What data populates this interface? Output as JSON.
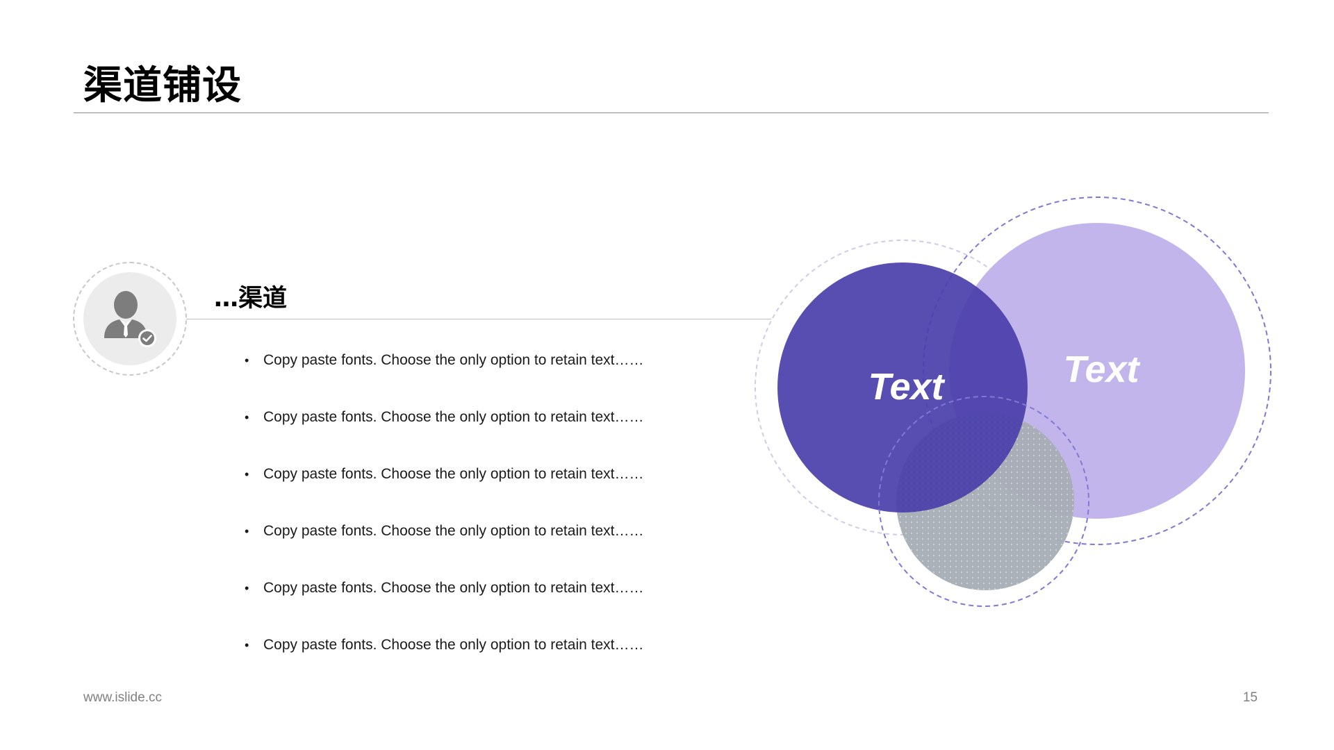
{
  "page": {
    "title": "渠道铺设",
    "footer_url": "www.islide.cc",
    "page_number": "15"
  },
  "section": {
    "title": "…渠道",
    "icon": "businessman-check-icon",
    "bullets": [
      "Copy paste fonts. Choose the only option to retain text……",
      "Copy paste fonts. Choose the only option to retain text……",
      "Copy paste fonts. Choose the only option to retain text……",
      "Copy paste fonts. Choose the only option to retain text……",
      "Copy paste fonts. Choose the only option to retain text……",
      "Copy paste fonts. Choose the only option to retain text……"
    ],
    "bullet_marker": "•"
  },
  "venn": {
    "left_label": "Text",
    "right_label": "Text",
    "colors": {
      "left_fill": "#4b3fab",
      "right_fill": "#c2b5eb",
      "bottom_fill": "#a7adb5",
      "dashed_ring": "#8078d4",
      "light_ring": "#d0cce8"
    }
  },
  "colors": {
    "title_text": "#000000",
    "body_text": "#1a1a1a",
    "footer_text": "#808080",
    "avatar_bg": "#ececec",
    "avatar_figure": "#7d7d7d"
  }
}
